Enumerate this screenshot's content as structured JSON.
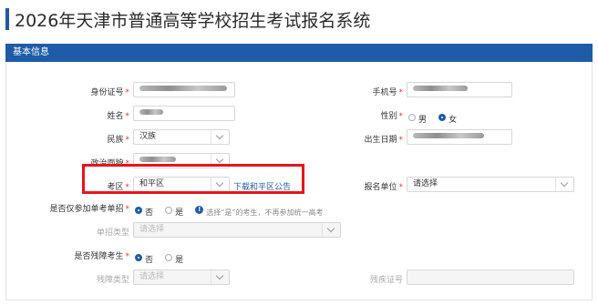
{
  "page": {
    "title": "2026年天津市普通高等学校招生考试报名系统",
    "section": "基本信息"
  },
  "form": {
    "id_label": "身份证号",
    "phone_label": "手机号",
    "name_label": "姓名",
    "gender_label": "性别",
    "gender_male": "男",
    "gender_female": "女",
    "gender_selected": "女",
    "ethnicity_label": "民族",
    "ethnicity_value": "汉族",
    "birth_label": "出生日期",
    "political_label": "政治面貌",
    "district_label": "考区",
    "district_value": "和平区",
    "district_link": "下载和平区公告",
    "unit_label": "报名单位",
    "unit_placeholder": "请选择",
    "only_single_label": "是否仅参加单考单招",
    "no_label": "否",
    "yes_label": "是",
    "only_single_hint": "选择“是”的考生，不再参加统一高考",
    "single_type_label": "单招类型",
    "single_type_placeholder": "请选择",
    "disabled_label": "是否残障考生",
    "disability_type_label": "残障类型",
    "disability_type_placeholder": "请选择",
    "disability_cert_label": "残疾证号"
  },
  "colors": {
    "accent": "#1e5ca8",
    "required": "#e33333",
    "highlight": "#e8141c"
  }
}
